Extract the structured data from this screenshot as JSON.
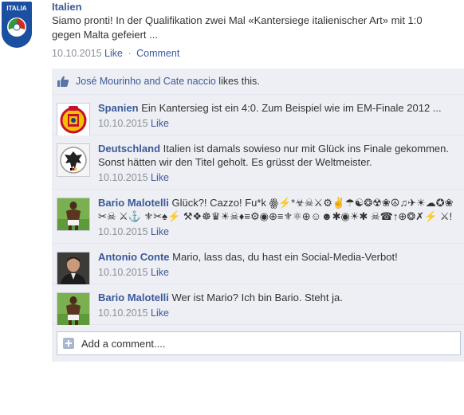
{
  "post": {
    "author": "Italien",
    "avatar_icon": "figc-italia-crest-icon",
    "avatar_text": "ITALIA",
    "text_line1": "Siamo pronti! In der Qualifikation zwei Mal «Kantersiege italienischer Art» mit 1:0",
    "text_line2": "gegen Malta gefeiert ...",
    "date": "10.10.2015",
    "like_label": "Like",
    "separator": "·",
    "comment_label": "Comment"
  },
  "likes": {
    "icon": "thumbs-up-icon",
    "names": "José Mourinho and Cate naccio",
    "suffix": " likes this."
  },
  "comments": [
    {
      "name": "Spanien",
      "avatar_icon": "spain-football-crest-icon",
      "text": " Ein Kantersieg ist ein 4:0. Zum Beispiel wie im EM-Finale 2012 ...",
      "date": "10.10.2015",
      "like": "Like"
    },
    {
      "name": "Deutschland",
      "avatar_icon": "germany-eagle-crest-icon",
      "text": " Italien ist damals sowieso nur mit Glück ins Finale gekommen. Sonst hätten wir den Titel geholt. Es grüsst der Weltmeister.",
      "date": "10.10.2015",
      "like": "Like"
    },
    {
      "name": "Bario Malotelli",
      "avatar_icon": "player-photo-icon",
      "text": " Glück?! Cazzo! Fu*k ꙮ⚡*☣☠⚔⚙✌☂☯❂☢❀☮♫✈☀☁✪❀✂☠ ⚔⚓ ⚜✂♠⚡ ⚒❖☸♛☀☠♦≡⚙◉⊕≡⚜⚛⊕☺☻✱◉☀✱ ☠☎↑⊕❂✗⚡ ⚔!",
      "date": "10.10.2015",
      "like": "Like"
    },
    {
      "name": "Antonio Conte",
      "avatar_icon": "coach-photo-icon",
      "text": " Mario, lass das, du hast ein Social-Media-Verbot!",
      "date": "10.10.2015",
      "like": "Like"
    },
    {
      "name": "Bario Malotelli",
      "avatar_icon": "player-photo-icon",
      "text": " Wer ist Mario? Ich bin Bario. Steht ja.",
      "date": "10.10.2015",
      "like": "Like"
    }
  ],
  "add_comment": {
    "icon": "plus-icon",
    "label": "Add a comment...."
  }
}
